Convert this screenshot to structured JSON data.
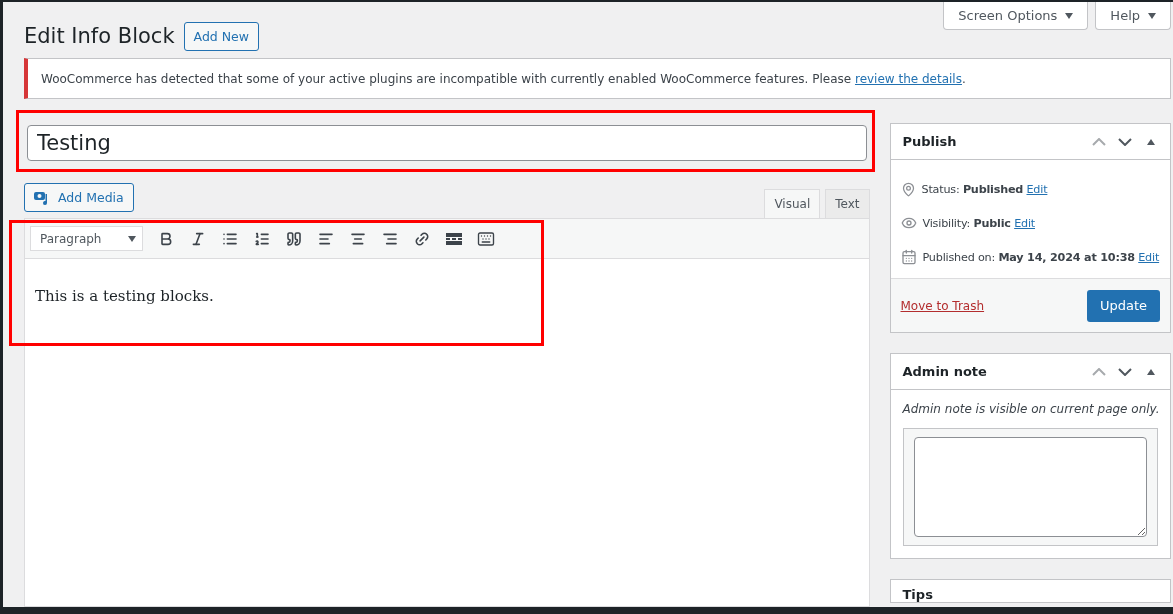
{
  "header": {
    "title": "Edit Info Block",
    "add_new": "Add New"
  },
  "top_buttons": [
    {
      "label": "Screen Options"
    },
    {
      "label": "Help"
    }
  ],
  "notice": {
    "text": "WooCommerce has detected that some of your active plugins are incompatible with currently enabled WooCommerce features. Please ",
    "link": "review the details",
    "end": "."
  },
  "title_field": {
    "value": "Testing",
    "highlighted": true
  },
  "add_media": "Add Media",
  "editor_tabs": [
    {
      "label": "Visual",
      "selected": true
    },
    {
      "label": "Text",
      "selected": false
    }
  ],
  "format_select": "Paragraph",
  "toolbar": [
    {
      "kind": "bold"
    },
    {
      "kind": "italic"
    },
    {
      "kind": "bullets"
    },
    {
      "kind": "numbers"
    },
    {
      "kind": "quote"
    },
    {
      "kind": "left"
    },
    {
      "kind": "center"
    },
    {
      "kind": "right"
    },
    {
      "kind": "link"
    },
    {
      "kind": "more"
    },
    {
      "kind": "kitchen"
    }
  ],
  "editor": {
    "content": "This is a testing blocks.",
    "highlighted": true
  },
  "publish": {
    "title": "Publish",
    "rows": [
      {
        "kind": "status",
        "label": "Status: ",
        "value": "Published",
        "link": "Edit"
      },
      {
        "kind": "visibility",
        "label": "Visibility: ",
        "value": "Public",
        "link": "Edit"
      },
      {
        "kind": "date",
        "label": "Published on: ",
        "value": "May 14, 2024 at 10:38",
        "link": "Edit"
      }
    ],
    "trash": "Move to Trash",
    "update": "Update"
  },
  "admin_note": {
    "title": "Admin note",
    "hint": "Admin note is visible on current page only."
  },
  "tips": {
    "title": "Tips"
  }
}
